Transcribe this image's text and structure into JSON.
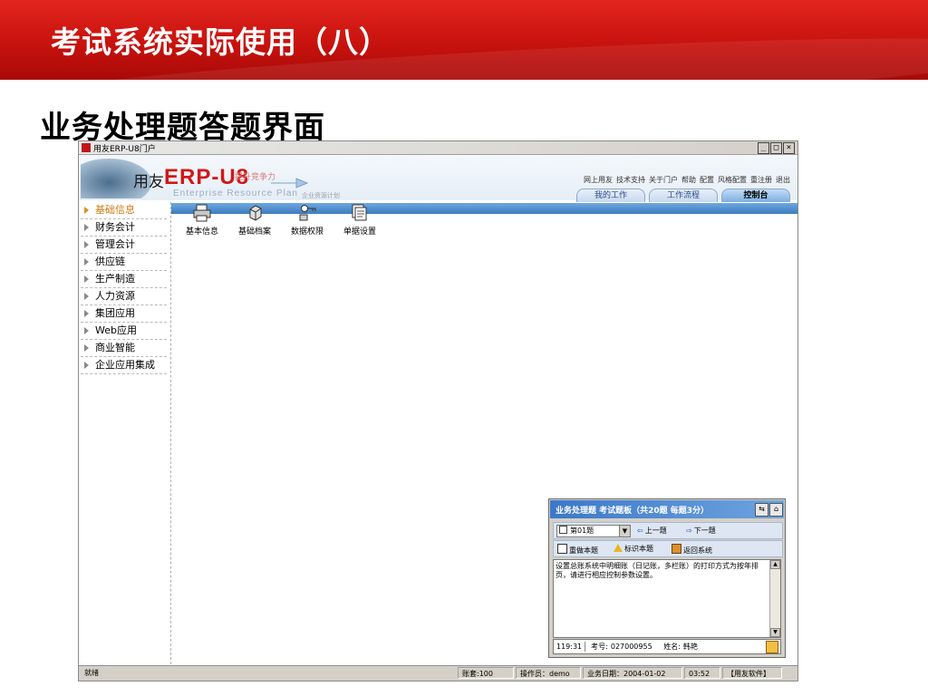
{
  "slide": {
    "title": "考试系统实际使用（八）",
    "subtitle": "业务处理题答题界面"
  },
  "window": {
    "title": "用友ERP-U8门户",
    "controls": [
      "_",
      "□",
      "×"
    ]
  },
  "banner": {
    "brand": "用友",
    "product_prefix": "ERP-",
    "product_suffix": "U8",
    "slogan": "提升竞争力",
    "tagline": "Enterprise Resource Plan",
    "tagline_small": "企业资源计划",
    "top_links": [
      "网上用友",
      "技术支持",
      "关于门户",
      "帮助",
      "配置",
      "风格配置",
      "重注册",
      "退出"
    ],
    "tabs": [
      {
        "label": "我的工作",
        "active": false
      },
      {
        "label": "工作流程",
        "active": false
      },
      {
        "label": "控制台",
        "active": true
      }
    ]
  },
  "sidebar": {
    "items": [
      {
        "label": "基础信息",
        "active": true
      },
      {
        "label": "财务会计",
        "active": false
      },
      {
        "label": "管理会计",
        "active": false
      },
      {
        "label": "供应链",
        "active": false
      },
      {
        "label": "生产制造",
        "active": false
      },
      {
        "label": "人力资源",
        "active": false
      },
      {
        "label": "集团应用",
        "active": false
      },
      {
        "label": "Web应用",
        "active": false
      },
      {
        "label": "商业智能",
        "active": false
      },
      {
        "label": "企业应用集成",
        "active": false
      }
    ]
  },
  "toolbar": {
    "items": [
      {
        "label": "基本信息",
        "icon": "printer-icon"
      },
      {
        "label": "基础档案",
        "icon": "cube-icon"
      },
      {
        "label": "数据权限",
        "icon": "key-icon"
      },
      {
        "label": "单据设置",
        "icon": "documents-icon"
      }
    ]
  },
  "exam_panel": {
    "title": "业务处理题 考试题板（共20题 每题3分）",
    "question_select": "第01题",
    "prev_label": "上一题",
    "next_label": "下一题",
    "redo_label": "重做本题",
    "mark_label": "标识本题",
    "return_label": "返回系统",
    "question_text": "设置总账系统中明细账（日记账，多栏账）的打印方式为按年排页，请进行相应控制参数设置。",
    "footer": {
      "time": "119:31",
      "exam_no_label": "考号:",
      "exam_no": "027000955",
      "name_label": "姓名:",
      "name": "韩艳"
    }
  },
  "statusbar": {
    "status": "就绪",
    "account": "账套:100",
    "operator": "操作员：demo",
    "business_date": "业务日期：2004-01-02",
    "time": "03:52",
    "brand": "【用友软件】"
  }
}
